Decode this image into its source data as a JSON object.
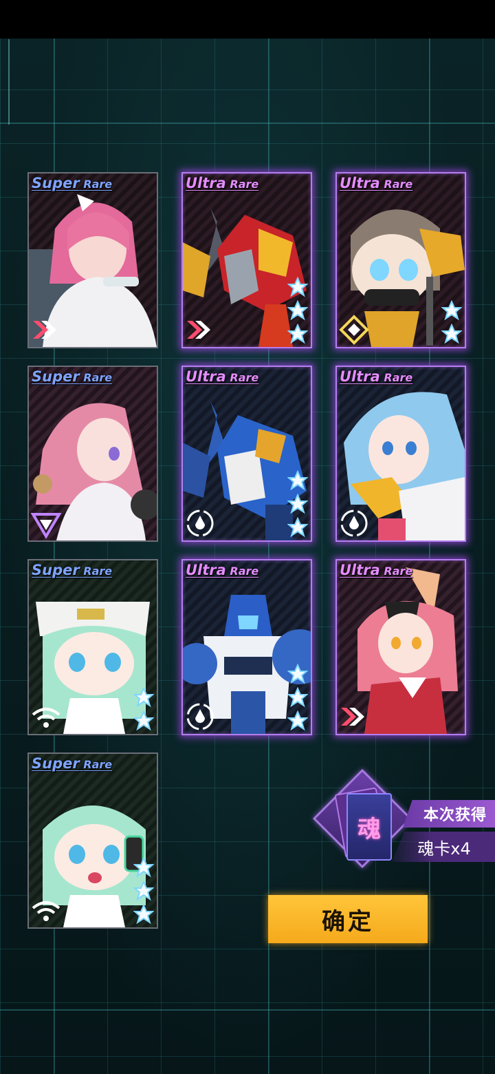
{
  "cards": [
    {
      "rarity_main": "Super",
      "rarity_sub": "Rare",
      "stars": 0,
      "class_icon": "chevrons-icon"
    },
    {
      "rarity_main": "Ultra",
      "rarity_sub": "Rare",
      "stars": 3,
      "class_icon": "chevrons-icon"
    },
    {
      "rarity_main": "Ultra",
      "rarity_sub": "Rare",
      "stars": 2,
      "class_icon": "diamond-icon"
    },
    {
      "rarity_main": "Super",
      "rarity_sub": "Rare",
      "stars": 0,
      "class_icon": "triangle-icon"
    },
    {
      "rarity_main": "Ultra",
      "rarity_sub": "Rare",
      "stars": 3,
      "class_icon": "drop-circle-icon"
    },
    {
      "rarity_main": "Ultra",
      "rarity_sub": "Rare",
      "stars": 0,
      "class_icon": "drop-circle-icon"
    },
    {
      "rarity_main": "Super",
      "rarity_sub": "Rare",
      "stars": 2,
      "class_icon": "wifi-icon"
    },
    {
      "rarity_main": "Ultra",
      "rarity_sub": "Rare",
      "stars": 3,
      "class_icon": "drop-circle-icon"
    },
    {
      "rarity_main": "Ultra",
      "rarity_sub": "Rare",
      "stars": 0,
      "class_icon": "chevrons-icon"
    },
    {
      "rarity_main": "Super",
      "rarity_sub": "Rare",
      "stars": 3,
      "class_icon": "wifi-icon"
    }
  ],
  "reward": {
    "card_glyph": "魂",
    "label": "本次获得",
    "count": "魂卡x4"
  },
  "confirm_button": {
    "label": "确定"
  },
  "colors": {
    "super_rare": "#7fa4ff",
    "ultra_rare": "#e58cff",
    "ultra_glow": "#a046e6",
    "confirm": "#f5a91b"
  }
}
